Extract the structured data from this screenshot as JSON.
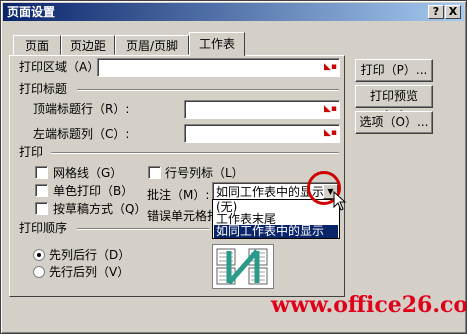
{
  "window": {
    "title": "页面设置",
    "help_button": "?",
    "close_button": "X"
  },
  "tabs": [
    {
      "label": "页面"
    },
    {
      "label": "页边距"
    },
    {
      "label": "页眉/页脚"
    },
    {
      "label": "工作表",
      "active": true
    }
  ],
  "sheet": {
    "print_area_label": "打印区域（A）:",
    "print_titles_section": "打印标题",
    "top_rows_label": "顶端标题行（R）:",
    "left_cols_label": "左端标题列（C）:",
    "print_section": "打印",
    "gridlines_label": "网格线（G）",
    "row_col_headers_label": "行号列标（L）",
    "black_white_label": "单色打印（B）",
    "comments_label": "批注（M）:",
    "draft_quality_label": "按草稿方式（Q）",
    "cell_errors_label": "错误单元格打",
    "page_order_section": "打印顺序",
    "down_then_over_label": "先列后行（D）",
    "over_then_down_label": "先行后列（V）"
  },
  "comments_combo": {
    "value": "如同工作表中的显示",
    "options": [
      "(无)",
      "工作表末尾",
      "如同工作表中的显示"
    ],
    "selected_index": 2
  },
  "buttons": {
    "print": "打印（P）...",
    "print_preview": "打印预览（W）",
    "options": "选项（O）..."
  },
  "watermark": {
    "text": "www.office26.com",
    "partial": "-1120"
  },
  "colors": {
    "title_bar_start": "#0a246a",
    "title_bar_end": "#a6caf0",
    "highlight": "#0a246a",
    "circle": "#d10000",
    "watermark": "#e0001a"
  }
}
